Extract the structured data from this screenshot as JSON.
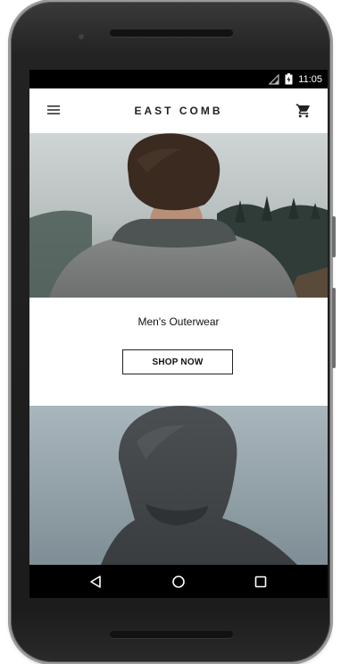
{
  "status_bar": {
    "time": "11:05",
    "icons": [
      "signal-icon",
      "battery-icon"
    ]
  },
  "app_bar": {
    "brand": "EAST COMB",
    "left_icon": "menu-icon",
    "right_icon": "cart-icon"
  },
  "promo": {
    "title": "Men's Outerwear",
    "cta_label": "SHOP NOW"
  },
  "nav_bar": {
    "icons": [
      "back-icon",
      "home-icon",
      "recent-apps-icon"
    ]
  },
  "colors": {
    "screen_background": "#ffffff",
    "text_primary": "#111111",
    "bar_black": "#000000"
  }
}
